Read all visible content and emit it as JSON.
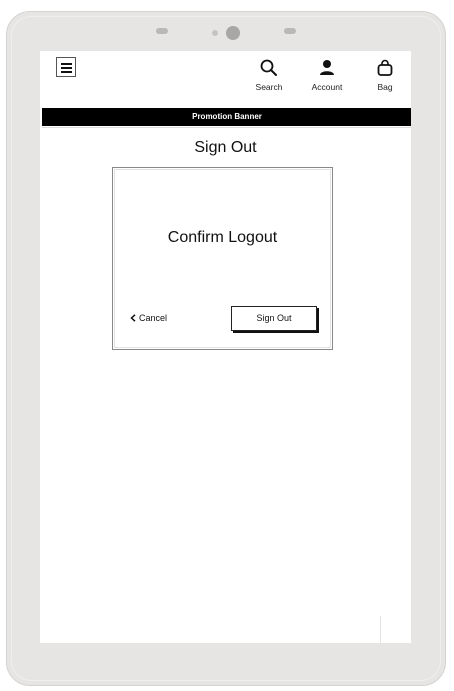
{
  "header": {
    "nav": {
      "search_label": "Search",
      "account_label": "Account",
      "bag_label": "Bag"
    },
    "icons": [
      "hamburger-menu-icon",
      "search-icon",
      "account-icon",
      "bag-icon"
    ]
  },
  "promotion_banner": {
    "text": "Promotion Banner"
  },
  "page": {
    "title": "Sign Out"
  },
  "dialog": {
    "title": "Confirm Logout",
    "cancel_label": "Cancel",
    "sign_out_label": "Sign Out"
  },
  "colors": {
    "device_frame": "#e6e5e4",
    "banner_background": "#000000",
    "banner_text": "#ffffff",
    "text": "#111111"
  }
}
